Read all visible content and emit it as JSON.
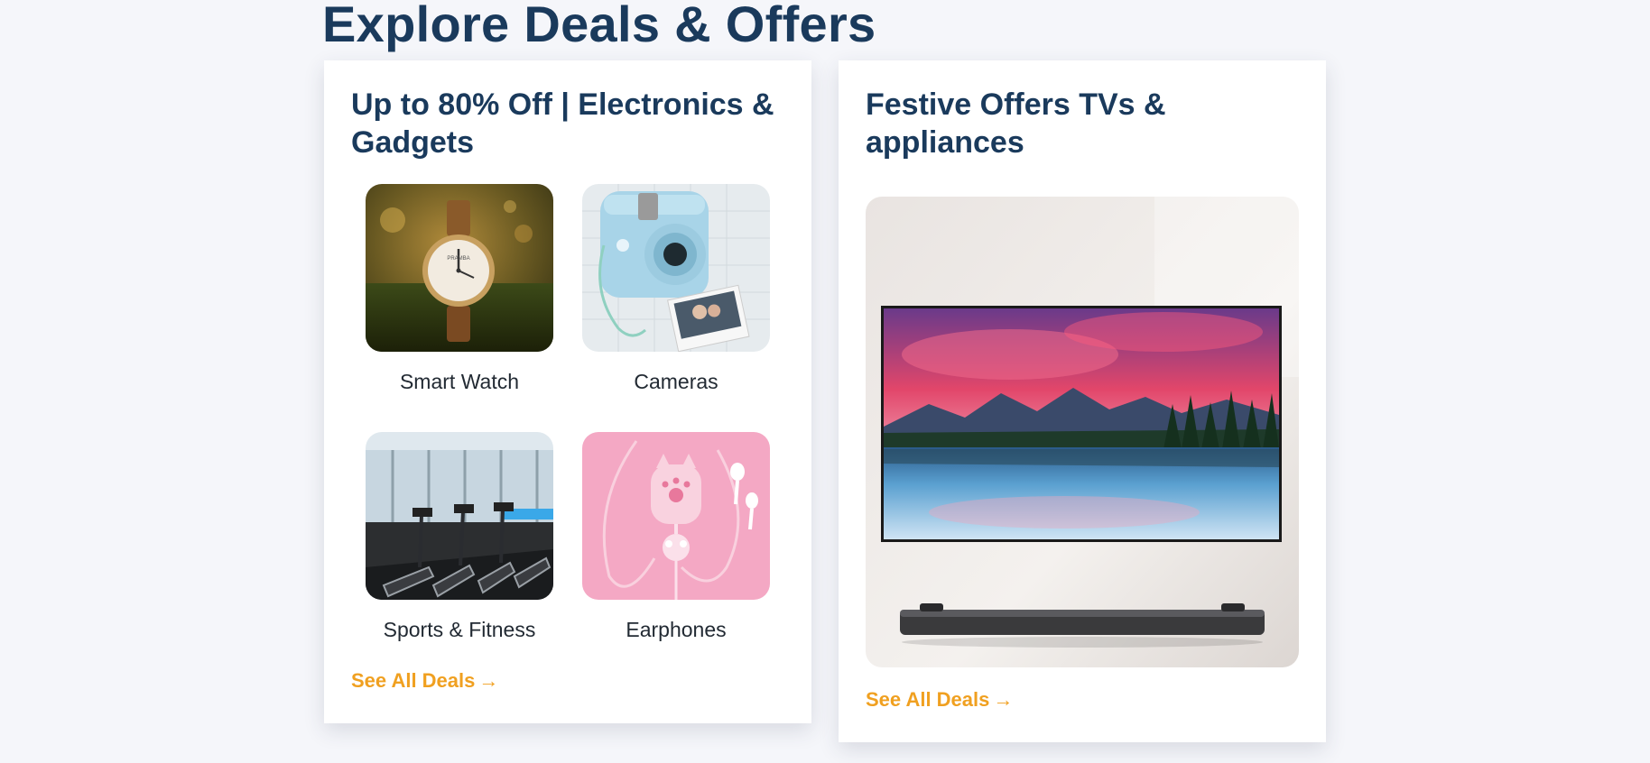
{
  "section": {
    "title": "Explore Deals & Offers"
  },
  "cards": [
    {
      "title": "Up to 80% Off | Electronics & Gadgets",
      "tiles": [
        {
          "label": "Smart Watch",
          "image": "watch-image"
        },
        {
          "label": "Cameras",
          "image": "camera-image"
        },
        {
          "label": "Sports & Fitness",
          "image": "gym-image"
        },
        {
          "label": "Earphones",
          "image": "earphones-image"
        }
      ],
      "see_all": "See All Deals",
      "arrow": "→"
    },
    {
      "title": "Festive Offers TVs & appliances",
      "image": "tv-image",
      "see_all": "See All Deals",
      "arrow": "→"
    }
  ],
  "colors": {
    "heading": "#1a3a5c",
    "link": "#f0a020",
    "background": "#f5f6fa"
  }
}
